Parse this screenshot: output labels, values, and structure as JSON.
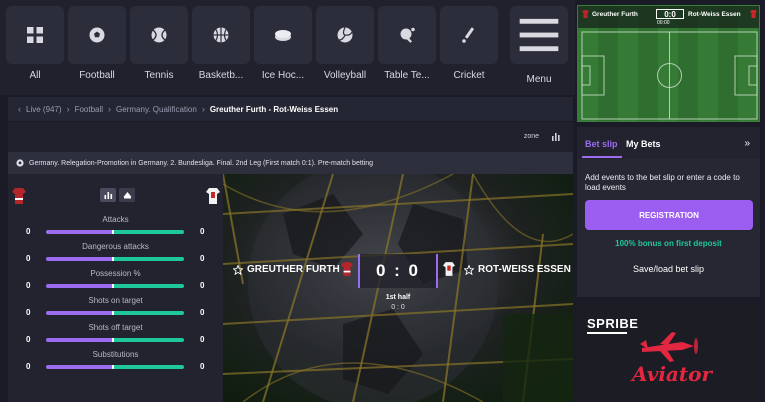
{
  "sports_nav": {
    "items": [
      {
        "label": "All",
        "icon": "grid-icon"
      },
      {
        "label": "Football",
        "icon": "football-icon"
      },
      {
        "label": "Tennis",
        "icon": "tennis-ball-icon"
      },
      {
        "label": "Basketb...",
        "icon": "basketball-icon"
      },
      {
        "label": "Ice Hoc...",
        "icon": "hockey-puck-icon"
      },
      {
        "label": "Volleyball",
        "icon": "volleyball-icon"
      },
      {
        "label": "Table Te...",
        "icon": "table-tennis-icon"
      },
      {
        "label": "Cricket",
        "icon": "cricket-icon"
      }
    ],
    "menu_label": "Menu"
  },
  "breadcrumb": {
    "live": "Live (947)",
    "sport": "Football",
    "tournament": "Germany. Qualification",
    "match": "Greuther Furth - Rot-Weiss Essen"
  },
  "toolbar": {
    "zone_label": "zone"
  },
  "league": "Germany. Relegation-Promotion in Germany. 2. Bundesliga. Final. 2nd Leg (First match 0:1). Pre-match betting",
  "stats": {
    "rows": [
      {
        "label": "Attacks",
        "home": "0",
        "away": "0"
      },
      {
        "label": "Dangerous attacks",
        "home": "0",
        "away": "0"
      },
      {
        "label": "Possession %",
        "home": "0",
        "away": "0"
      },
      {
        "label": "Shots on target",
        "home": "0",
        "away": "0"
      },
      {
        "label": "Shots off target",
        "home": "0",
        "away": "0"
      },
      {
        "label": "Substitutions",
        "home": "0",
        "away": "0"
      }
    ]
  },
  "match": {
    "home": "GREUTHER FURTH",
    "away": "ROT-WEISS ESSEN",
    "score": "0 : 0",
    "period": "1st half",
    "period_score": "0 : 0"
  },
  "mini_pitch": {
    "home": "Greuther Furth",
    "away": "Rot-Weiss Essen",
    "score": "0:0",
    "clock": "00:00"
  },
  "betslip": {
    "tab_active": "Bet slip",
    "tab_other": "My Bets",
    "info": "Add events to the bet slip or enter a code to load events",
    "register": "REGISTRATION",
    "bonus": "100% bonus on first deposit",
    "load": "Save/load bet slip"
  },
  "promo": {
    "provider": "SPRIBE",
    "game": "Aviator"
  },
  "colors": {
    "accent": "#9b6cf0",
    "positive": "#1fc79c",
    "background": "#1a1b26",
    "promo_red": "#e32740"
  }
}
